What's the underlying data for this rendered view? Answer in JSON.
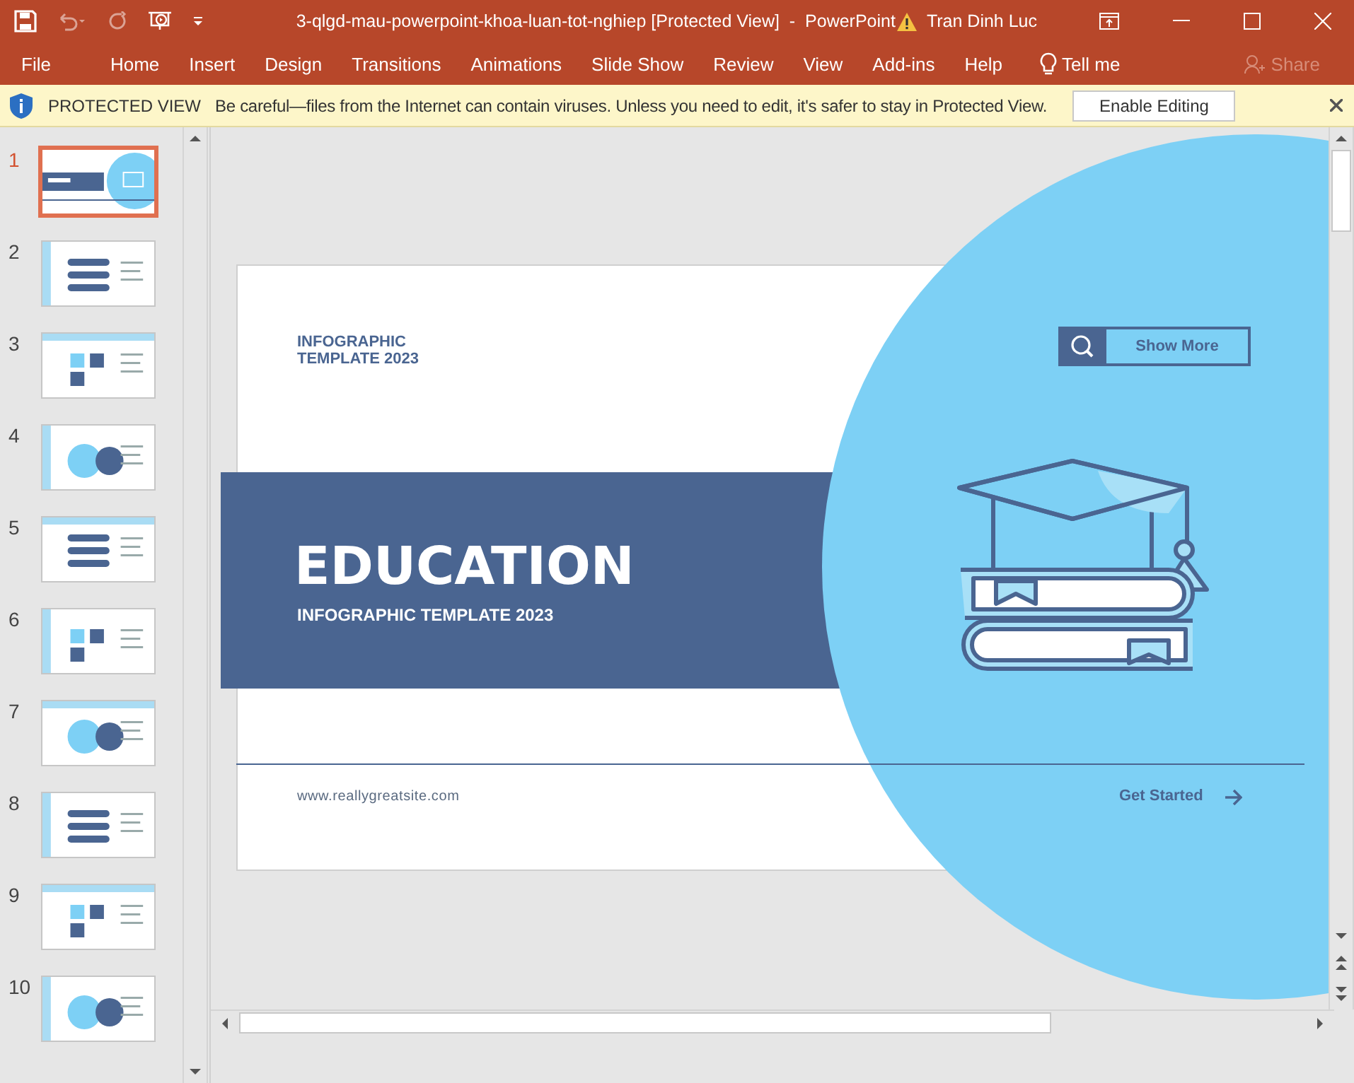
{
  "window": {
    "title": "3-qlgd-mau-powerpoint-khoa-luan-tot-nghiep [Protected View]  -  PowerPoint",
    "user": "Tran Dinh Luc"
  },
  "ribbon_tabs": [
    {
      "label": "File",
      "selected": false
    },
    {
      "label": "Home",
      "selected": false
    },
    {
      "label": "Insert",
      "selected": false
    },
    {
      "label": "Design",
      "selected": false
    },
    {
      "label": "Transitions",
      "selected": false
    },
    {
      "label": "Animations",
      "selected": false
    },
    {
      "label": "Slide Show",
      "selected": false
    },
    {
      "label": "Review",
      "selected": false
    },
    {
      "label": "View",
      "selected": false
    },
    {
      "label": "Add-ins",
      "selected": false
    },
    {
      "label": "Help",
      "selected": false
    }
  ],
  "tell_me": "Tell me",
  "share": {
    "label": "Share",
    "disabled": true
  },
  "protected_view": {
    "title": "PROTECTED VIEW",
    "message": "Be careful—files from the Internet can contain viruses. Unless you need to edit, it's safer to stay in Protected View.",
    "button": "Enable Editing"
  },
  "slides": [
    {
      "number": "1",
      "selected": true
    },
    {
      "number": "2",
      "selected": false
    },
    {
      "number": "3",
      "selected": false
    },
    {
      "number": "4",
      "selected": false
    },
    {
      "number": "5",
      "selected": false
    },
    {
      "number": "6",
      "selected": false
    },
    {
      "number": "7",
      "selected": false
    },
    {
      "number": "8",
      "selected": false
    },
    {
      "number": "9",
      "selected": false
    },
    {
      "number": "10",
      "selected": false
    }
  ],
  "slide": {
    "tag": "INFOGRAPHIC\nTEMPLATE 2023",
    "heading": "EDUCATION",
    "subheading": "INFOGRAPHIC TEMPLATE 2023",
    "button": "Show More",
    "website": "www.reallygreatsite.com",
    "link": "Get Started"
  }
}
